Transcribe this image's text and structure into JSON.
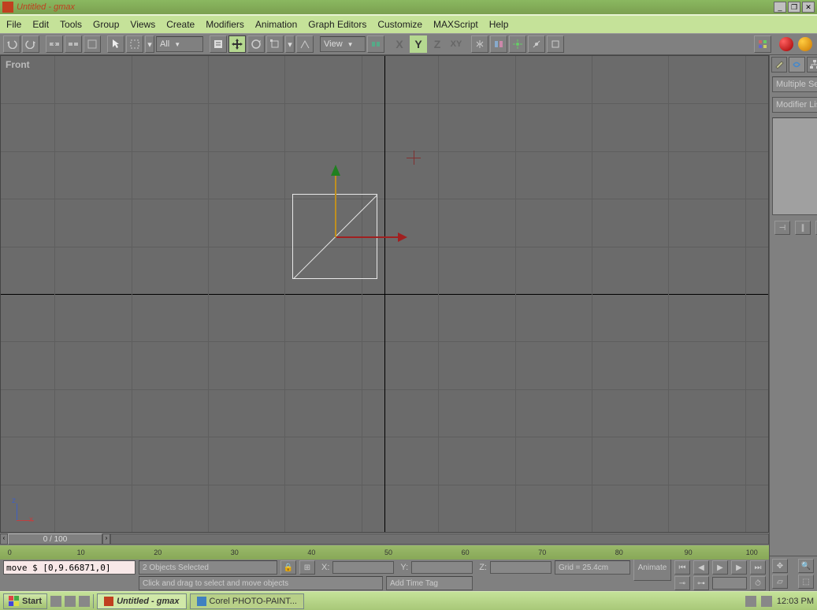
{
  "title": "Untitled - gmax",
  "menu": [
    "File",
    "Edit",
    "Tools",
    "Group",
    "Views",
    "Create",
    "Modifiers",
    "Animation",
    "Graph Editors",
    "Customize",
    "MAXScript",
    "Help"
  ],
  "toolbar": {
    "selset_label": "All",
    "view_label": "View"
  },
  "viewport": {
    "label": "Front",
    "axis_z": "z",
    "axis_x": "x"
  },
  "timeslider": {
    "pos": "0 / 100"
  },
  "ruler": [
    "0",
    "10",
    "20",
    "30",
    "40",
    "50",
    "60",
    "70",
    "80",
    "90",
    "100"
  ],
  "status": {
    "cmd": "move $ [0,9.66871,0]",
    "sel": "2 Objects Selected",
    "hint": "Click and drag to select and move objects",
    "x": "X:",
    "y": "Y:",
    "z": "Z:",
    "grid": "Grid = 25.4cm",
    "timetag": "Add Time Tag",
    "animate": "Animate"
  },
  "cmdpanel": {
    "selection": "Multiple Selected",
    "modifier": "Modifier List"
  },
  "taskbar": {
    "start": "Start",
    "app1": "Untitled - gmax",
    "app2": "Corel PHOTO-PAINT...",
    "time": "12:03 PM"
  }
}
